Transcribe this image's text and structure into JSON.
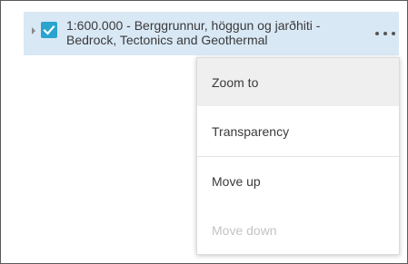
{
  "layer": {
    "title": "1:600.000 - Berggrunnur, höggun og jarðhiti -\nBedrock, Tectonics and Geothermal",
    "checked": true,
    "checkbox_color": "#2aa3cf",
    "row_highlight_color": "#d9e8f5"
  },
  "icons": {
    "expander": "caret-right-icon",
    "checkbox": "checkmark-icon",
    "more": "ellipsis-icon"
  },
  "menu": {
    "zoom_to": "Zoom to",
    "transparency": "Transparency",
    "move_up": "Move up",
    "move_down": "Move down"
  }
}
